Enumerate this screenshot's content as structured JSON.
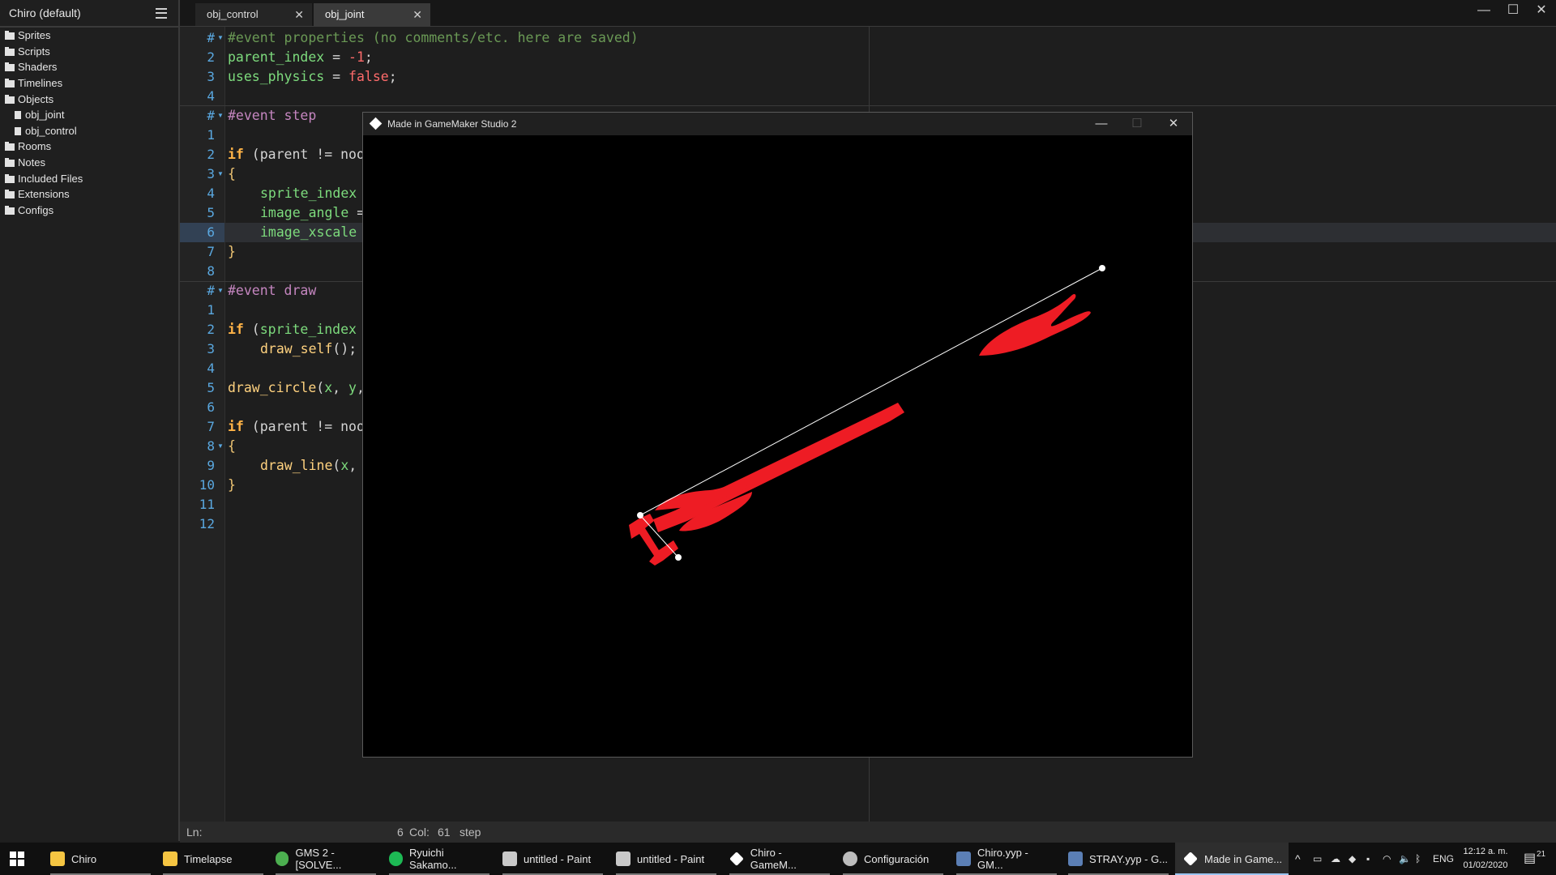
{
  "sidebar": {
    "title": "Chiro (default)",
    "items": [
      {
        "label": "Sprites",
        "type": "folder"
      },
      {
        "label": "Scripts",
        "type": "folder"
      },
      {
        "label": "Shaders",
        "type": "folder"
      },
      {
        "label": "Timelines",
        "type": "folder"
      },
      {
        "label": "Objects",
        "type": "folder-open"
      },
      {
        "label": "obj_joint",
        "type": "file"
      },
      {
        "label": "obj_control",
        "type": "file"
      },
      {
        "label": "Rooms",
        "type": "folder"
      },
      {
        "label": "Notes",
        "type": "folder"
      },
      {
        "label": "Included Files",
        "type": "folder"
      },
      {
        "label": "Extensions",
        "type": "folder"
      },
      {
        "label": "Configs",
        "type": "folder"
      }
    ]
  },
  "tabs": [
    {
      "label": "obj_control",
      "active": false
    },
    {
      "label": "obj_joint",
      "active": true
    }
  ],
  "gutter": [
    "#",
    "2",
    "3",
    "4",
    "#",
    "1",
    "2",
    "3",
    "4",
    "5",
    "6",
    "7",
    "8",
    "#",
    "1",
    "2",
    "3",
    "4",
    "5",
    "6",
    "7",
    "8",
    "9",
    "10",
    "11",
    "12"
  ],
  "code": {
    "l0": "#event properties (no comments/etc. here are saved)",
    "l1a": "parent_index",
    "l1b": " = ",
    "l1c": "-1",
    "l1d": ";",
    "l2a": "uses_physics",
    "l2b": " = ",
    "l2c": "false",
    "l2d": ";",
    "l4": "#event step",
    "l6a": "if",
    "l6b": " (parent != noo",
    "l7": "{",
    "l8": "sprite_index",
    "l9a": "image_angle",
    "l9b": " =",
    "l10": "image_xscale",
    "l11": "}",
    "l13": "#event draw",
    "l15a": "if",
    "l15b": " (",
    "l15c": "sprite_index",
    "l16a": "draw_self",
    "l16b": "();",
    "l18a": "draw_circle",
    "l18b": "(",
    "l18c": "x",
    "l18d": ", ",
    "l18e": "y",
    "l18f": ",",
    "l20a": "if",
    "l20b": " (parent != noo",
    "l21": "{",
    "l22a": "draw_line",
    "l22b": "(",
    "l22c": "x",
    "l22d": ",",
    "l23": "}"
  },
  "status": {
    "ln_label": "Ln:",
    "ln_value": "6",
    "col_label": "Col:",
    "col_value": "61",
    "event": "step"
  },
  "game_window": {
    "title": "Made in GameMaker Studio 2"
  },
  "taskbar": {
    "items": [
      {
        "label": "Chiro"
      },
      {
        "label": "Timelapse"
      },
      {
        "label": "GMS 2 - [SOLVE..."
      },
      {
        "label": "Ryuichi Sakamo..."
      },
      {
        "label": "untitled - Paint"
      },
      {
        "label": "untitled - Paint"
      },
      {
        "label": "Chiro - GameM..."
      },
      {
        "label": "Configuración"
      },
      {
        "label": "Chiro.yyp - GM..."
      },
      {
        "label": "STRAY.yyp - G..."
      },
      {
        "label": "Made in Game..."
      }
    ],
    "lang": "ENG",
    "time": "12:12 a. m.",
    "date": "01/02/2020",
    "notif_count": "21"
  },
  "colors": {
    "accent": "#5aa8e0",
    "sprite": "#ee1c24",
    "background": "#1e1e1e"
  }
}
